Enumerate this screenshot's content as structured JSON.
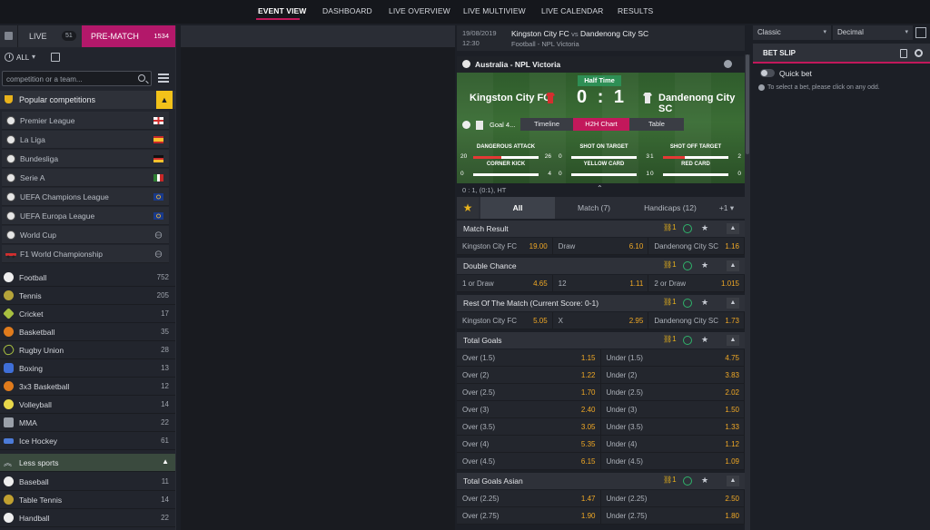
{
  "nav": {
    "items": [
      "EVENT VIEW",
      "DASHBOARD",
      "LIVE OVERVIEW",
      "LIVE MULTIVIEW",
      "LIVE CALENDAR",
      "RESULTS"
    ]
  },
  "left": {
    "tab_live": "LIVE",
    "tab_live_count": "51",
    "tab_prematch": "PRE-MATCH",
    "tab_prematch_count": "1534",
    "filter_all": "ALL",
    "search_placeholder": "competition or a team...",
    "popular_label": "Popular competitions",
    "competitions": [
      {
        "name": "Premier League"
      },
      {
        "name": "La Liga"
      },
      {
        "name": "Bundesliga"
      },
      {
        "name": "Serie A"
      },
      {
        "name": "UEFA Champions League"
      },
      {
        "name": "UEFA Europa League"
      },
      {
        "name": "World Cup"
      },
      {
        "name": "F1 World Championship"
      }
    ],
    "sports": [
      {
        "name": "Football",
        "count": "752"
      },
      {
        "name": "Tennis",
        "count": "205"
      },
      {
        "name": "Cricket",
        "count": "17"
      },
      {
        "name": "Basketball",
        "count": "35"
      },
      {
        "name": "Rugby Union",
        "count": "28"
      },
      {
        "name": "Boxing",
        "count": "13"
      },
      {
        "name": "3x3 Basketball",
        "count": "12"
      },
      {
        "name": "Volleyball",
        "count": "14"
      },
      {
        "name": "MMA",
        "count": "22"
      },
      {
        "name": "Ice Hockey",
        "count": "61"
      }
    ],
    "less_sports": "Less sports",
    "more_sports": [
      {
        "name": "Baseball",
        "count": "11"
      },
      {
        "name": "Table Tennis",
        "count": "14"
      },
      {
        "name": "Handball",
        "count": "22"
      }
    ]
  },
  "event": {
    "date": "19/08/2019",
    "time": "12:30",
    "home": "Kingston City FC",
    "vs": "vs",
    "away": "Dandenong City SC",
    "league": "Football - NPL Victoria",
    "pitch_title": "Australia - NPL Victoria",
    "status": "Half Time",
    "home_team": "Kingston City FC",
    "away_team": "Dandenong City SC",
    "score_home": "0",
    "score_sep": ":",
    "score_away": "1",
    "goal_text": "Goal 4...",
    "view_tabs": [
      "Timeline",
      "H2H Chart",
      "Table"
    ],
    "stats": [
      {
        "label": "DANGEROUS ATTACK",
        "home": "20",
        "away": "26",
        "share": 0.43
      },
      {
        "label": "SHOT ON TARGET",
        "home": "0",
        "away": "3",
        "share": 0.0
      },
      {
        "label": "SHOT OFF TARGET",
        "home": "1",
        "away": "2",
        "share": 0.33
      },
      {
        "label": "CORNER KICK",
        "home": "0",
        "away": "4",
        "share": 0.0
      },
      {
        "label": "YELLOW CARD",
        "home": "0",
        "away": "1",
        "share": 0.0
      },
      {
        "label": "RED CARD",
        "home": "0",
        "away": "0",
        "share": 0.0
      }
    ],
    "score_detail": "0 : 1, (0:1), HT",
    "market_tabs": [
      "All",
      "Match (7)",
      "Handicaps (12)",
      "+1"
    ],
    "markets": [
      {
        "title": "Match Result",
        "count": "1",
        "rows": [
          [
            {
              "n": "Kingston City FC",
              "v": "19.00"
            },
            {
              "n": "Draw",
              "v": "6.10"
            },
            {
              "n": "Dandenong City SC",
              "v": "1.16"
            }
          ]
        ]
      },
      {
        "title": "Double Chance",
        "count": "1",
        "rows": [
          [
            {
              "n": "1 or Draw",
              "v": "4.65"
            },
            {
              "n": "12",
              "v": "1.11"
            },
            {
              "n": "2 or Draw",
              "v": "1.015"
            }
          ]
        ]
      },
      {
        "title": "Rest Of The Match (Current Score: 0-1)",
        "count": "1",
        "rows": [
          [
            {
              "n": "Kingston City FC",
              "v": "5.05"
            },
            {
              "n": "X",
              "v": "2.95"
            },
            {
              "n": "Dandenong City SC",
              "v": "1.73"
            }
          ]
        ]
      },
      {
        "title": "Total Goals",
        "count": "1",
        "rows": [
          [
            {
              "n": "Over (1.5)",
              "v": "1.15"
            },
            {
              "n": "Under (1.5)",
              "v": "4.75"
            }
          ],
          [
            {
              "n": "Over (2)",
              "v": "1.22"
            },
            {
              "n": "Under (2)",
              "v": "3.83"
            }
          ],
          [
            {
              "n": "Over (2.5)",
              "v": "1.70"
            },
            {
              "n": "Under (2.5)",
              "v": "2.02"
            }
          ],
          [
            {
              "n": "Over (3)",
              "v": "2.40"
            },
            {
              "n": "Under (3)",
              "v": "1.50"
            }
          ],
          [
            {
              "n": "Over (3.5)",
              "v": "3.05"
            },
            {
              "n": "Under (3.5)",
              "v": "1.33"
            }
          ],
          [
            {
              "n": "Over (4)",
              "v": "5.35"
            },
            {
              "n": "Under (4)",
              "v": "1.12"
            }
          ],
          [
            {
              "n": "Over (4.5)",
              "v": "6.15"
            },
            {
              "n": "Under (4.5)",
              "v": "1.09"
            }
          ]
        ]
      },
      {
        "title": "Total Goals Asian",
        "count": "1",
        "rows": [
          [
            {
              "n": "Over (2.25)",
              "v": "1.47"
            },
            {
              "n": "Under (2.25)",
              "v": "2.50"
            }
          ],
          [
            {
              "n": "Over (2.75)",
              "v": "1.90"
            },
            {
              "n": "Under (2.75)",
              "v": "1.80"
            }
          ]
        ]
      }
    ]
  },
  "betslip": {
    "odds_format": "Classic",
    "odds_type": "Decimal",
    "title": "BET SLIP",
    "quick_bet": "Quick bet",
    "hint": "To select a bet, please click on any odd."
  },
  "colors": {
    "accent": "#c2185b",
    "odds": "#f0a825",
    "highlight": "#f2c21a"
  }
}
